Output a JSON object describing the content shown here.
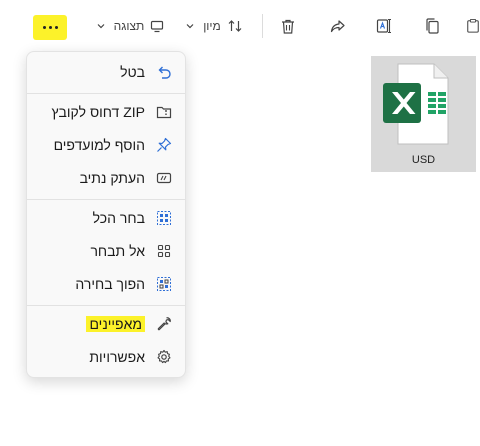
{
  "colors": {
    "highlight": "#fcf22a",
    "accent": "#2f6fd6",
    "excel_green": "#1e7145"
  },
  "toolbar": {
    "more_icon": "more-horizontal-icon",
    "view_label": "תצוגה",
    "sort_label": "מיון",
    "delete_icon": "trash-icon",
    "share_icon": "share-icon",
    "rename_icon": "rename-icon",
    "copy_icon": "copy-icon",
    "paste_icon": "paste-icon"
  },
  "menu": {
    "items": [
      {
        "label": "בטל",
        "icon": "undo-icon"
      },
      {
        "label": "דחוס לקובץ ZIP",
        "icon": "zip-icon"
      },
      {
        "label": "הוסף למועדפים",
        "icon": "pin-icon"
      },
      {
        "label": "העתק נתיב",
        "icon": "copy-path-icon"
      },
      {
        "label": "בחר הכל",
        "icon": "select-all-icon"
      },
      {
        "label": "אל תבחר",
        "icon": "select-none-icon"
      },
      {
        "label": "הפוך בחירה",
        "icon": "invert-selection-icon"
      },
      {
        "label": "מאפיינים",
        "icon": "wrench-icon",
        "highlighted": true
      },
      {
        "label": "אפשרויות",
        "icon": "gear-icon"
      }
    ]
  },
  "file": {
    "name": "USD",
    "icon": "excel-file-icon"
  }
}
